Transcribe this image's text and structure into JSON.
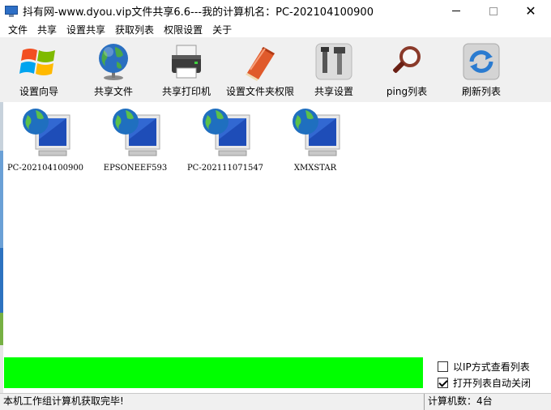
{
  "window": {
    "title": "抖有网-www.dyou.vip文件共享6.6---我的计算机名：PC-202104100900"
  },
  "menu": [
    {
      "label": "文件"
    },
    {
      "label": "共享"
    },
    {
      "label": "设置共享"
    },
    {
      "label": "获取列表"
    },
    {
      "label": "权限设置"
    },
    {
      "label": "关于"
    }
  ],
  "toolbar": [
    {
      "label": "设置向导",
      "icon": "windows-logo-icon"
    },
    {
      "label": "共享文件",
      "icon": "globe-icon"
    },
    {
      "label": "共享打印机",
      "icon": "printer-icon"
    },
    {
      "label": "设置文件夹权限",
      "icon": "folder-book-icon"
    },
    {
      "label": "共享设置",
      "icon": "tools-icon"
    },
    {
      "label": "ping列表",
      "icon": "magnifier-icon"
    },
    {
      "label": "刷新列表",
      "icon": "refresh-icon"
    }
  ],
  "computers": [
    {
      "name": "PC-202104100900"
    },
    {
      "name": "EPSONEEF593"
    },
    {
      "name": "PC-202111071547"
    },
    {
      "name": "XMXSTAR"
    }
  ],
  "options": {
    "ip_view": {
      "label": "以IP方式查看列表",
      "checked": false
    },
    "auto_close": {
      "label": "打开列表自动关闭",
      "checked": true
    }
  },
  "progress": {
    "value": 1.0,
    "color": "#00ff00"
  },
  "status": {
    "message": "本机工作组计算机获取完毕!",
    "count": "计算机数：4台"
  }
}
